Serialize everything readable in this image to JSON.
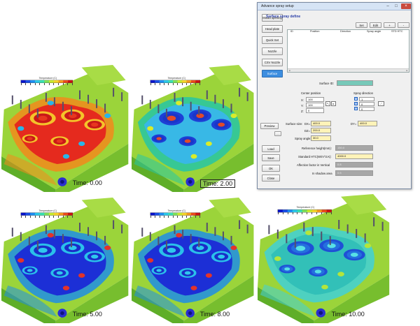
{
  "panels": [
    {
      "id": "p1",
      "scale_label": "Temperature (C)",
      "time_label": "Time:",
      "time_value": "0.00",
      "boxed": false,
      "heat": "hot"
    },
    {
      "id": "p2",
      "scale_label": "Temperature (C)",
      "time_label": "Time:",
      "time_value": "2.00",
      "boxed": true,
      "heat": "cool"
    },
    {
      "id": "p3",
      "scale_label": "Temperature (C)",
      "time_label": "Time:",
      "time_value": "5.00",
      "boxed": false,
      "heat": "cold"
    },
    {
      "id": "p4",
      "scale_label": "Temperature (C)",
      "time_label": "Time:",
      "time_value": "8.00",
      "boxed": false,
      "heat": "cold"
    },
    {
      "id": "p5",
      "scale_label": "Temperature (C)",
      "time_label": "Time:",
      "time_value": "10.00",
      "boxed": false,
      "heat": "warm"
    }
  ],
  "dialog": {
    "title": "Advance spray setup",
    "minimize_glyph": "–",
    "maximize_glyph": "□",
    "close_glyph": "×",
    "left_buttons": {
      "mould_opening": "Mould opening",
      "head_plate": "Head plate",
      "quick_set": "Quick Set",
      "nozzle": "Nozzle",
      "csv_nozzle": "CSV Nozzle",
      "surface": "Surface",
      "preview": "Preview",
      "dots": "...",
      "load": "Load",
      "save": "Save",
      "ok": "OK",
      "close": "Close"
    },
    "group_title": "Surface spray define",
    "table_buttons": {
      "set": "Set",
      "edit": "Edit",
      "add": "+",
      "remove": "-"
    },
    "table_headers": {
      "id": "ID",
      "position": "Position",
      "direction": "Direction",
      "spray_angle": "Spray angle",
      "std_htc": "STD HTC"
    },
    "surface_id_label": "Surface ID:",
    "center_position_label": "Center position",
    "spray_direction_label": "Spray direction",
    "center": {
      "x_label": "X:",
      "x": "100",
      "y_label": "Y:",
      "y": "100",
      "z_label": "Z:",
      "z": "0"
    },
    "direction": {
      "x": "1",
      "y": "0",
      "z": "0"
    },
    "surface_size_label": "Surface size:",
    "dx_label": "DX=",
    "dx": "400.0",
    "dy_label": "DY=",
    "dy": "400.0",
    "dz_label": "DZ=",
    "dz": "200.0",
    "spray_angle_label": "Spray angle:",
    "spray_angle": "30.0",
    "reference_height_label": "Reference height(mm):",
    "reference_height": "150.0",
    "standard_htc_label": "Standard HTC(W/m^2.K):",
    "standard_htc": "4000.0",
    "affection_label": "Affection factor in Vertical",
    "affection": "0.8",
    "shadow_label": "In shadow area",
    "shadow": "0.5"
  }
}
